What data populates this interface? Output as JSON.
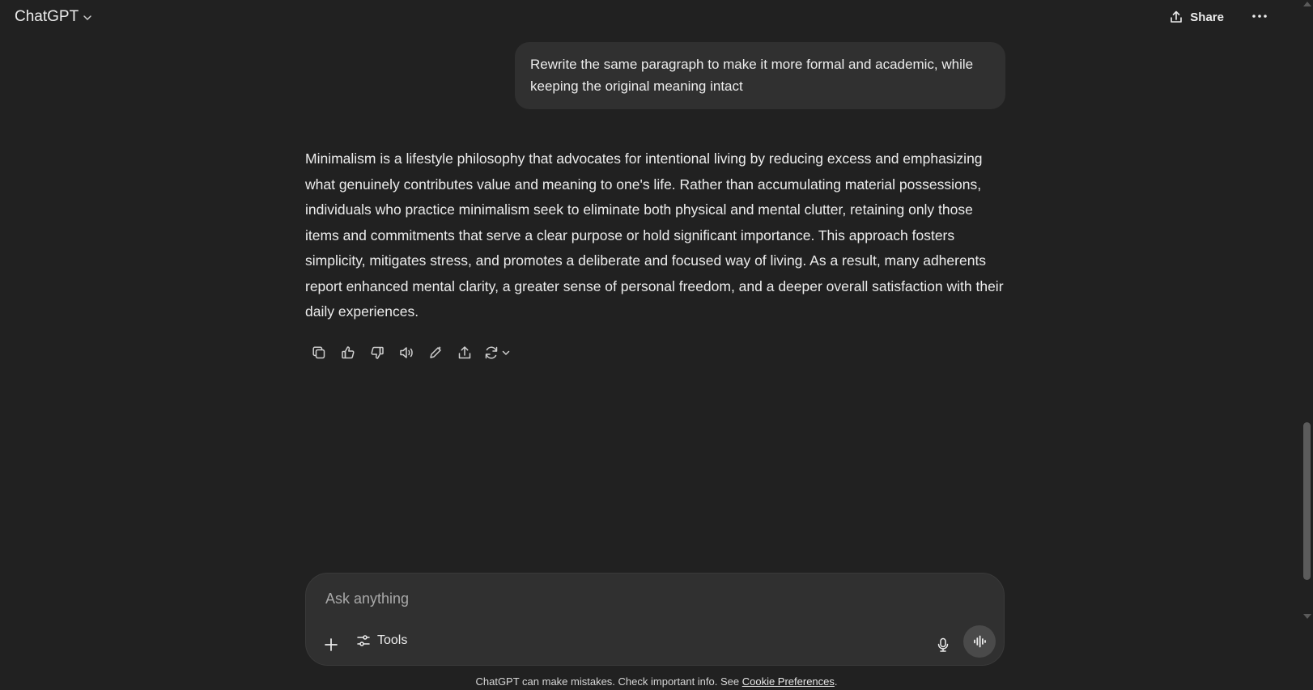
{
  "header": {
    "model_label": "ChatGPT",
    "share_label": "Share"
  },
  "conversation": {
    "user_message": "Rewrite the same paragraph to make it more formal and academic, while keeping the original meaning intact",
    "assistant_message": "Minimalism is a lifestyle philosophy that advocates for intentional living by reducing excess and emphasizing what genuinely contributes value and meaning to one's life. Rather than accumulating material possessions, individuals who practice minimalism seek to eliminate both physical and mental clutter, retaining only those items and commitments that serve a clear purpose or hold significant importance. This approach fosters simplicity, mitigates stress, and promotes a deliberate and focused way of living. As a result, many adherents report enhanced mental clarity, a greater sense of personal freedom, and a deeper overall satisfaction with their daily experiences."
  },
  "message_actions": [
    "copy-icon",
    "thumbs-up-icon",
    "thumbs-down-icon",
    "read-aloud-icon",
    "edit-in-canvas-icon",
    "share-icon",
    "regenerate-icon"
  ],
  "composer": {
    "placeholder": "Ask anything",
    "tools_label": "Tools"
  },
  "footer": {
    "note": "ChatGPT can make mistakes. Check important info. See ",
    "link_label": "Cookie Preferences",
    "note_end": "."
  },
  "colors": {
    "background": "#212121",
    "bubble": "#303030",
    "text": "#ececec"
  }
}
